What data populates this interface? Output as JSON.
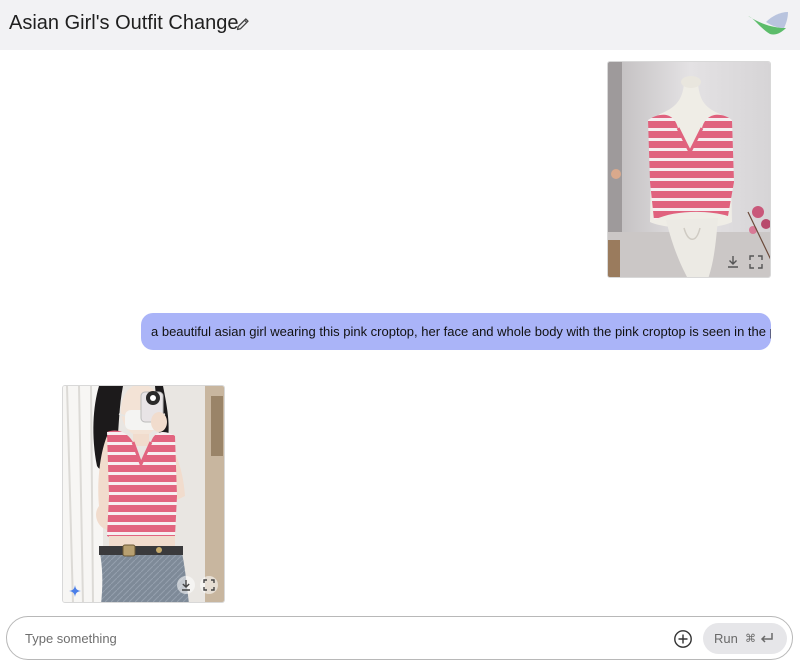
{
  "header": {
    "title": "Asian Girl's Outfit Change",
    "edit_icon": "pencil-icon",
    "logo": "ai-studio-logo"
  },
  "conversation": {
    "user_image": {
      "subject": "pink and white striped v-neck crop top on a white mannequin",
      "actions": [
        "download-icon",
        "fullscreen-icon"
      ]
    },
    "user_message": {
      "text": "a beautiful asian girl wearing this pink croptop, her face and whole body with the pink croptop is seen in the photo"
    },
    "model_image": {
      "subject": "girl taking mirror selfie wearing pink striped crop top and jeans",
      "badge_icon": "sparkle-icon",
      "actions": [
        "download-icon",
        "fullscreen-icon"
      ]
    }
  },
  "input": {
    "placeholder": "Type something",
    "value": "",
    "add_icon": "add-circle-icon",
    "run_label": "Run",
    "shortcut_icons": [
      "command-key-icon",
      "enter-key-icon"
    ]
  },
  "colors": {
    "header_bg": "#f2f2f4",
    "user_bubble": "#aab4f8",
    "run_button_bg": "#e6e6e9",
    "top_stripe": "#e0627e",
    "logo_green": "#5cbc6a",
    "logo_blue": "#b9c4de"
  }
}
